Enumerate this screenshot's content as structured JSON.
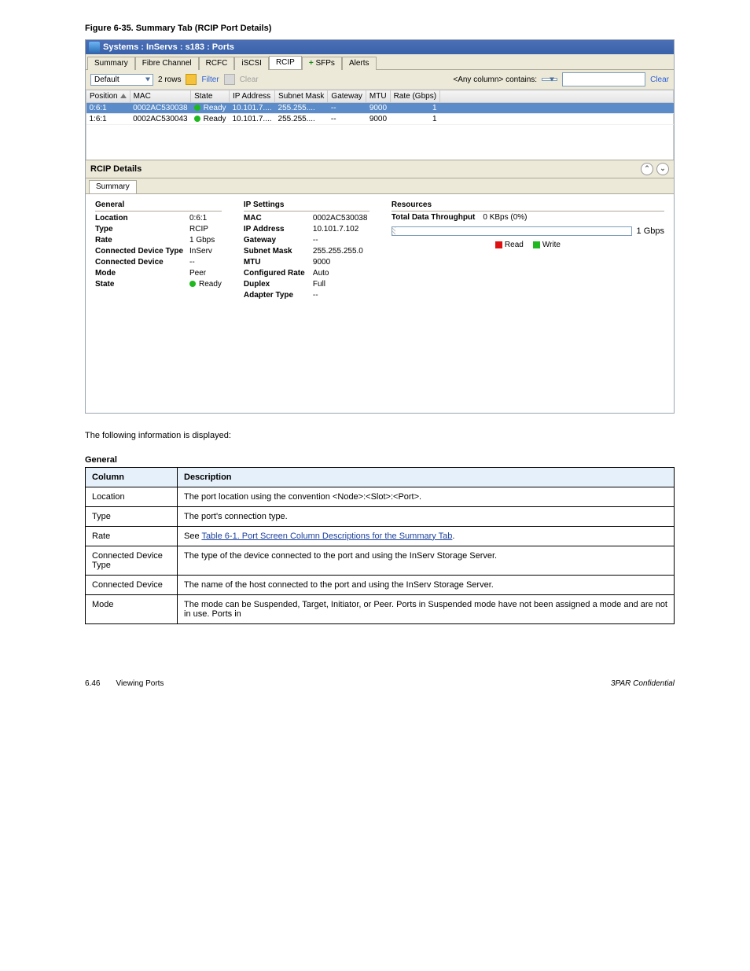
{
  "figure_caption": "Figure 6-35.  Summary Tab (RCIP Port Details)",
  "window_title": "Systems : InServs : s183 : Ports",
  "top_tabs": [
    "Summary",
    "Fibre Channel",
    "RCFC",
    "iSCSI",
    "RCIP",
    "SFPs",
    "Alerts"
  ],
  "top_tabs_active_index": 4,
  "sfp_badge": "+",
  "toolbar": {
    "filter_dropdown": "Default",
    "rows_label": "2 rows",
    "filter_label": "Filter",
    "clear_label": "Clear",
    "any_column": "<Any column> contains:",
    "clear_link": "Clear"
  },
  "columns": [
    "Position",
    "MAC",
    "State",
    "IP Address",
    "Subnet Mask",
    "Gateway",
    "MTU",
    "Rate (Gbps)"
  ],
  "rows": [
    {
      "position": "0:6:1",
      "mac": "0002AC530038",
      "state": "Ready",
      "ip": "10.101.7....",
      "mask": "255.255....",
      "gw": "--",
      "mtu": "9000",
      "rate": "1"
    },
    {
      "position": "1:6:1",
      "mac": "0002AC530043",
      "state": "Ready",
      "ip": "10.101.7....",
      "mask": "255.255....",
      "gw": "--",
      "mtu": "9000",
      "rate": "1"
    }
  ],
  "details_header": "RCIP Details",
  "details_subtab": "Summary",
  "general": {
    "title": "General",
    "items": [
      {
        "k": "Location",
        "v": "0:6:1"
      },
      {
        "k": "Type",
        "v": "RCIP"
      },
      {
        "k": "Rate",
        "v": "1 Gbps"
      },
      {
        "k": "Connected Device Type",
        "v": "InServ"
      },
      {
        "k": "Connected Device",
        "v": "--"
      },
      {
        "k": "Mode",
        "v": "Peer"
      },
      {
        "k": "State",
        "v": "● Ready",
        "dot": true
      }
    ]
  },
  "ip_settings": {
    "title": "IP Settings",
    "items": [
      {
        "k": "MAC",
        "v": "0002AC530038"
      },
      {
        "k": "IP Address",
        "v": "10.101.7.102"
      },
      {
        "k": "Gateway",
        "v": "--"
      },
      {
        "k": "Subnet Mask",
        "v": "255.255.255.0"
      },
      {
        "k": "MTU",
        "v": "9000"
      },
      {
        "k": "Configured Rate",
        "v": "Auto"
      },
      {
        "k": "Duplex",
        "v": "Full"
      },
      {
        "k": "Adapter Type",
        "v": "--"
      }
    ]
  },
  "resources": {
    "title": "Resources",
    "throughput_label": "Total Data Throughput",
    "throughput_value": "0 KBps (0%)",
    "scale_max": "1 Gbps",
    "legend_read": "Read",
    "legend_write": "Write"
  },
  "intro_text": "The following information is displayed:",
  "cat_general": "General",
  "desc_rows": [
    {
      "col": "Column",
      "desc": "Description",
      "header": true
    },
    {
      "col": "Location",
      "desc": "The port location using the convention <Node>:<Slot>:<Port>."
    },
    {
      "col": "Type",
      "desc": "The port's connection type."
    },
    {
      "col": "Rate",
      "desc_html": "See <a class='doc-link' href='#'>Table 6-1. Port Screen Column Descriptions for the Summary Tab</a>."
    },
    {
      "col": "Connected Device Type",
      "desc": "The type of the device connected to the port and using the InServ Storage Server."
    },
    {
      "col": "Connected Device",
      "desc": "The name of the host connected to the port and using the InServ Storage Server."
    },
    {
      "col": "Mode",
      "desc": "The mode can be Suspended, Target, Initiator, or Peer. Ports in Suspended mode have not been assigned a mode and are not in use. Ports in"
    }
  ],
  "footer_page": "6.46",
  "footer_text": "Viewing Ports",
  "footer_right": "3PAR Confidential"
}
